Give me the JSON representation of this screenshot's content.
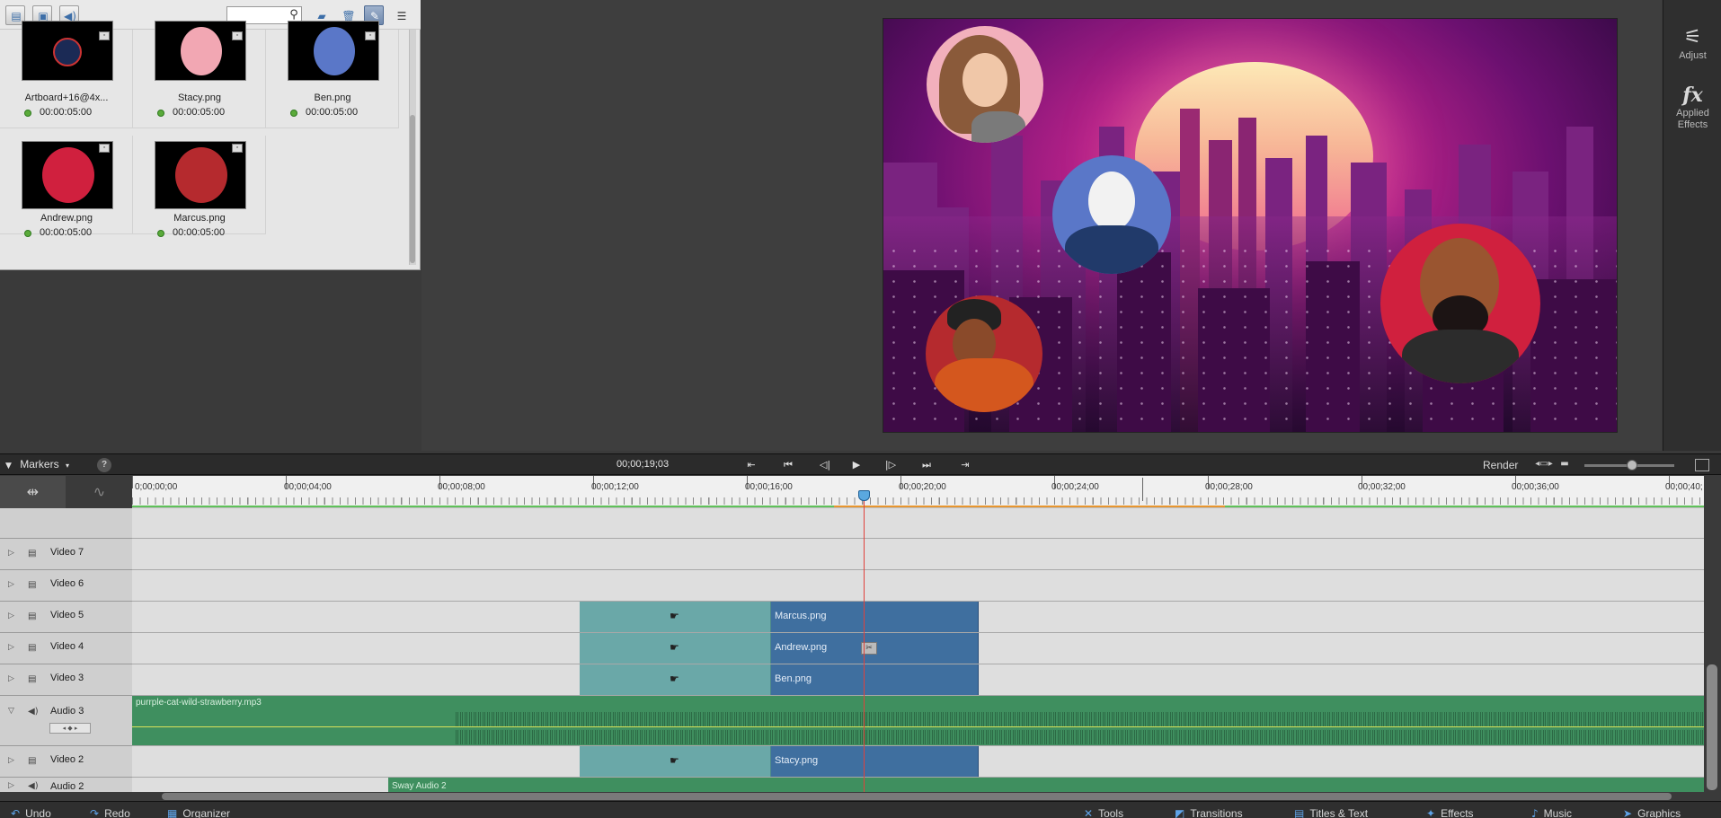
{
  "assets": {
    "search_placeholder": "",
    "toolbar_icons": [
      "video-filter-icon",
      "image-filter-icon",
      "audio-filter-icon",
      "new-folder-icon",
      "delete-icon",
      "pin-icon",
      "panel-menu-icon"
    ],
    "items": [
      {
        "name": "Artboard+16@4x...",
        "duration": "00:00:05:00",
        "thumb_color": "#1b2a55"
      },
      {
        "name": "Stacy.png",
        "duration": "00:00:05:00",
        "thumb_color": "#f2a7b3"
      },
      {
        "name": "Ben.png",
        "duration": "00:00:05:00",
        "thumb_color": "#5a77c8"
      },
      {
        "name": "Andrew.png",
        "duration": "00:00:05:00",
        "thumb_color": "#d0203e"
      },
      {
        "name": "Marcus.png",
        "duration": "00:00:05:00",
        "thumb_color": "#b52a2e"
      }
    ]
  },
  "right_panel": {
    "adjust_label": "Adjust",
    "applied_effects_line1": "Applied",
    "applied_effects_line2": "Effects",
    "fx_glyph": "fx"
  },
  "timeline_bar": {
    "markers_label": "Markers",
    "help_glyph": "?",
    "timecode": "00;00;19;03",
    "render_label": "Render"
  },
  "ruler": {
    "labels": [
      "0;00;00;00",
      "00;00;04;00",
      "00;00;08;00",
      "00;00;12;00",
      "00;00;16;00",
      "00;00;20;00",
      "00;00;24;00",
      "00;00;28;00",
      "00;00;32;00",
      "00;00;36;00",
      "00;00;40;"
    ]
  },
  "tracks": {
    "video7": "Video 7",
    "video6": "Video 6",
    "video5": "Video 5",
    "video4": "Video 4",
    "video3": "Video 3",
    "audio3": "Audio 3",
    "video2": "Video 2",
    "audio2": "Audio 2"
  },
  "clips": {
    "marcus": "Marcus.png",
    "andrew": "Andrew.png",
    "ben": "Ben.png",
    "stacy": "Stacy.png",
    "audio3": "purrple-cat-wild-strawberry.mp3",
    "audio2": "Sway Audio 2"
  },
  "bottom_bar": {
    "undo": "Undo",
    "redo": "Redo",
    "organizer": "Organizer",
    "tools": "Tools",
    "transitions": "Transitions",
    "titles": "Titles & Text",
    "effects": "Effects",
    "music": "Music",
    "graphics": "Graphics"
  },
  "colors": {
    "accent": "#5fa3e8",
    "clip_blue": "#3f6f9f",
    "clip_teal": "#6aa8a8",
    "audio_green": "#3f8f5f",
    "playhead": "#e0423c"
  }
}
